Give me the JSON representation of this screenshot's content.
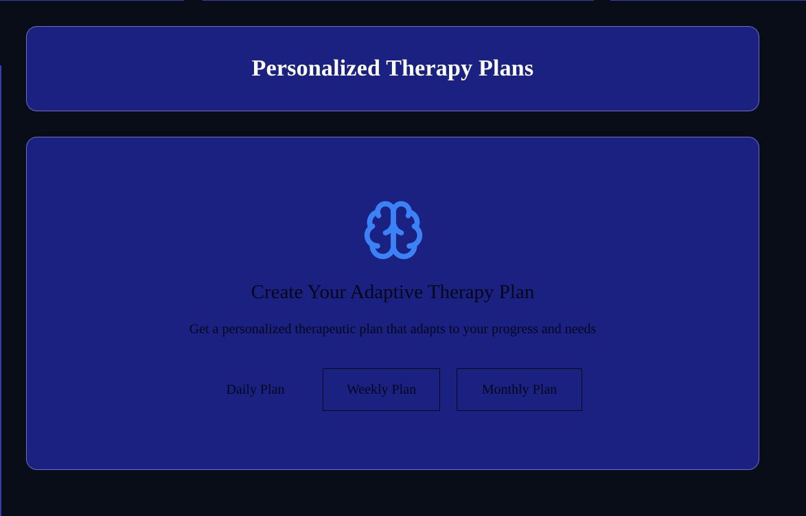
{
  "header": {
    "title": "Personalized Therapy Plans"
  },
  "main": {
    "icon": "brain-icon",
    "heading": "Create Your Adaptive Therapy Plan",
    "subtitle": "Get a personalized therapeutic plan that adapts to your progress and needs",
    "plans": [
      {
        "label": "Daily Plan",
        "outlined": false
      },
      {
        "label": "Weekly Plan",
        "outlined": true
      },
      {
        "label": "Monthly Plan",
        "outlined": true
      }
    ]
  },
  "colors": {
    "page_background": "#090d18",
    "card_background": "#1a2180",
    "card_border": "#6b70c4",
    "icon": "#3b82f6",
    "title_text": "#ffffff",
    "body_text": "#05071a"
  }
}
